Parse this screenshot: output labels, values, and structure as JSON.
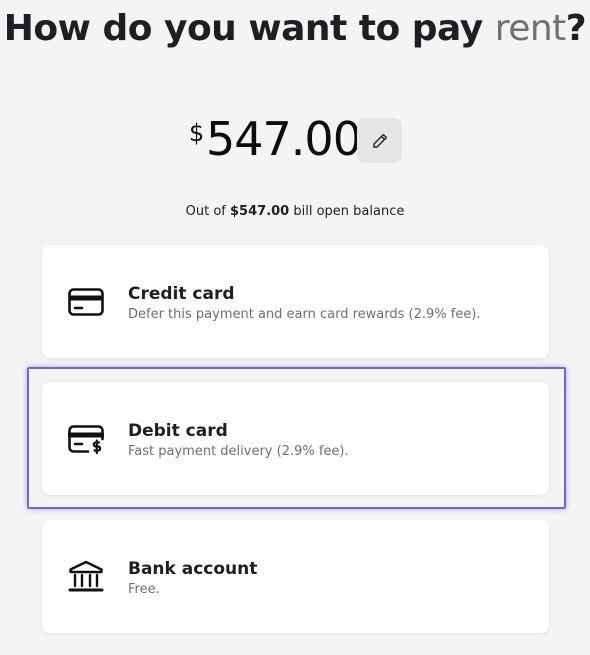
{
  "header": {
    "title_prefix": "How do you want to pay ",
    "title_highlight": "rent",
    "title_suffix": "?"
  },
  "payment": {
    "currency_symbol": "$",
    "amount": "547.00",
    "balance_prefix": "Out of ",
    "balance_amount": "$547.00",
    "balance_suffix": " bill open balance"
  },
  "options": [
    {
      "name": "Credit card",
      "description": "Defer this payment and earn card rewards (2.9% fee).",
      "icon": "credit-card-icon"
    },
    {
      "name": "Debit card",
      "description": "Fast payment delivery (2.9% fee).",
      "icon": "debit-card-dollar-icon",
      "selected": true
    },
    {
      "name": "Bank account",
      "description": "Free.",
      "icon": "bank-icon"
    }
  ],
  "colors": {
    "background": "#f4f4f4",
    "card": "#ffffff",
    "highlight_border": "#7660ec",
    "title_highlight": "#707070",
    "text": "#1e1e24",
    "muted_text": "#6e6e78"
  }
}
